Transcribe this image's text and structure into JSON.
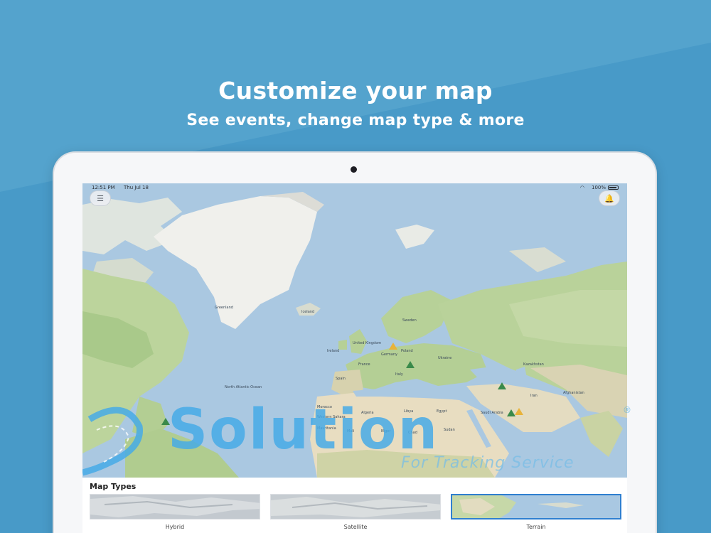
{
  "header": {
    "headline": "Customize your map",
    "subheadline": "See events, change map type & more"
  },
  "status_bar": {
    "time": "12:51 PM",
    "date": "Thu Jul 18",
    "battery": "100%"
  },
  "map": {
    "labels": {
      "greenland": "Greenland",
      "iceland": "Iceland",
      "ocean": "North Atlantic Ocean",
      "uk": "United Kingdom",
      "ireland": "Ireland",
      "spain": "Spain",
      "france": "France",
      "germany": "Germany",
      "poland": "Poland",
      "ukraine": "Ukraine",
      "italy": "Italy",
      "sweden": "Sweden",
      "algeria": "Algeria",
      "libya": "Libya",
      "egypt": "Egypt",
      "mali": "Mali",
      "niger": "Niger",
      "chad": "Chad",
      "sudan": "Sudan",
      "mauritania": "Mauritania",
      "saudi": "Saudi Arabia",
      "iran": "Iran",
      "kazakhstan": "Kazakhstan",
      "western_sahara": "Western Sahara",
      "morocco": "Morocco",
      "afghanistan": "Afghanistan"
    }
  },
  "watermark": {
    "main": "Solution",
    "sub": "For Tracking Service",
    "reg": "®"
  },
  "panel": {
    "title": "Map Types",
    "types": [
      {
        "label": "Hybrid"
      },
      {
        "label": "Satellite"
      },
      {
        "label": "Terrain"
      }
    ],
    "selected": "Terrain"
  },
  "colors": {
    "background": "#4a9cc8",
    "ocean": "#a9c7e0",
    "land_green": "#b9d29a",
    "land_sand": "#e6dcc2",
    "ice": "#f1f1ee",
    "selection": "#2f7fd0"
  },
  "icons": {
    "menu": "menu-icon",
    "notification": "bell-icon",
    "wifi": "wifi-icon",
    "battery": "battery-icon"
  }
}
